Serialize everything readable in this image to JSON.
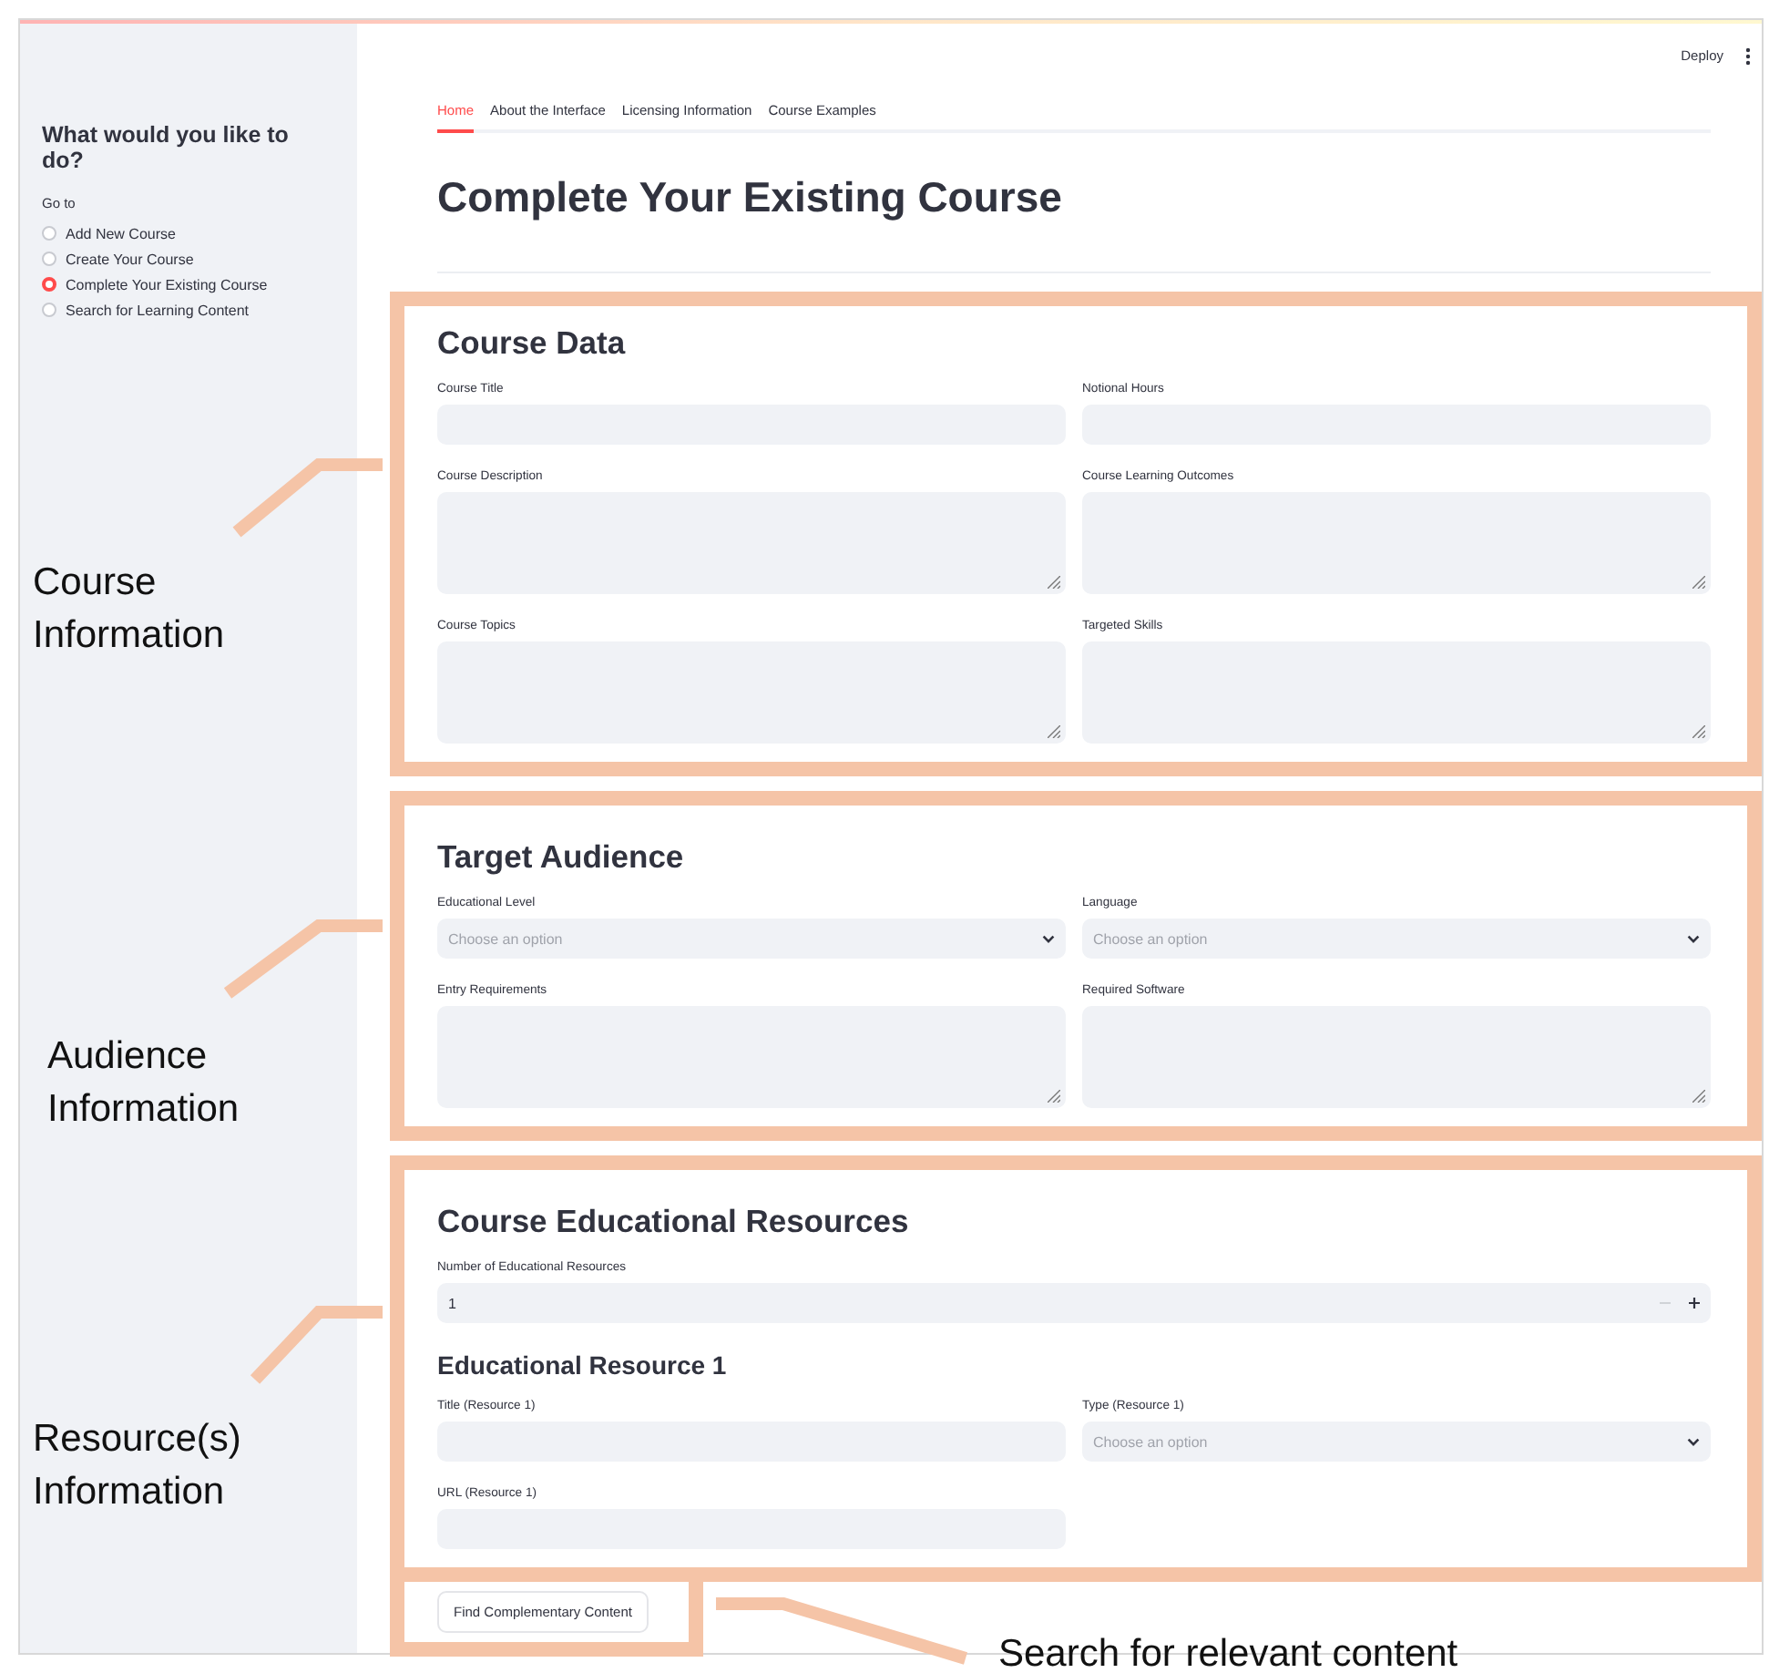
{
  "sidebar": {
    "title": "What would you like to do?",
    "group_label": "Go to",
    "options": [
      {
        "label": "Add New Course",
        "selected": false
      },
      {
        "label": "Create Your Course",
        "selected": false
      },
      {
        "label": "Complete Your Existing Course",
        "selected": true
      },
      {
        "label": "Search for Learning Content",
        "selected": false
      }
    ]
  },
  "header": {
    "deploy": "Deploy"
  },
  "tabs": [
    {
      "label": "Home",
      "selected": true
    },
    {
      "label": "About the Interface",
      "selected": false
    },
    {
      "label": "Licensing Information",
      "selected": false
    },
    {
      "label": "Course Examples",
      "selected": false
    }
  ],
  "title": "Complete Your Existing Course",
  "sections": [
    {
      "title": "Course Data",
      "blocks": [
        {
          "kind": "fields",
          "fields": [
            {
              "label": "Course Title",
              "kind": "text"
            },
            {
              "label": "Notional Hours",
              "kind": "text"
            },
            {
              "label": "Course Description",
              "kind": "textarea"
            },
            {
              "label": "Course Learning Outcomes",
              "kind": "textarea"
            },
            {
              "label": "Course Topics",
              "kind": "textarea"
            },
            {
              "label": "Targeted Skills",
              "kind": "textarea"
            }
          ]
        }
      ]
    },
    {
      "title": "Target Audience",
      "blocks": [
        {
          "kind": "fields",
          "fields": [
            {
              "label": "Educational Level",
              "kind": "select",
              "placeholder": "Choose an option"
            },
            {
              "label": "Language",
              "kind": "select",
              "placeholder": "Choose an option"
            },
            {
              "label": "Entry Requirements",
              "kind": "textarea"
            },
            {
              "label": "Required Software",
              "kind": "textarea"
            }
          ]
        }
      ]
    },
    {
      "title": "Course Educational Resources",
      "blocks": [
        {
          "kind": "fields",
          "fields": [
            {
              "label": "Number of Educational Resources",
              "kind": "number",
              "value": "1"
            }
          ]
        },
        {
          "kind": "subheading",
          "text": "Educational Resource 1"
        },
        {
          "kind": "fields",
          "fields": [
            {
              "label": "Title (Resource 1)",
              "kind": "text"
            },
            {
              "label": "Type (Resource 1)",
              "kind": "select",
              "placeholder": "Choose an option"
            },
            {
              "label": "URL (Resource 1)",
              "kind": "text"
            }
          ]
        }
      ]
    }
  ],
  "button": "Find Complementary Content",
  "annotations": [
    "Course\nInformation",
    "Audience\nInformation",
    "Resource(s)\nInformation",
    "Search for relevant content"
  ]
}
